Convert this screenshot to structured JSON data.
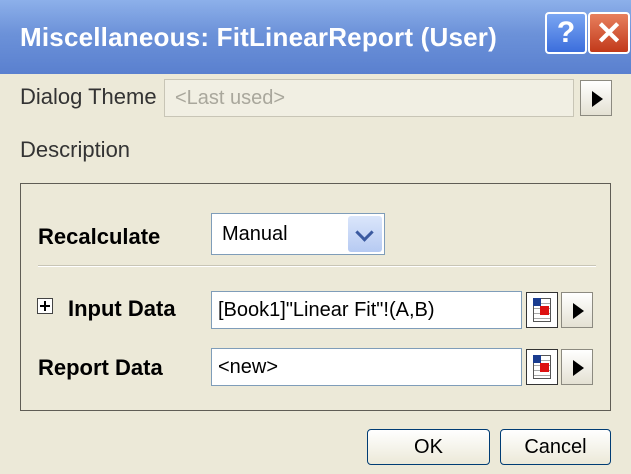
{
  "window": {
    "title": "Miscellaneous: FitLinearReport (User)",
    "help_label": "?",
    "close_label": "✕"
  },
  "dialog_theme": {
    "label": "Dialog Theme",
    "value": "<Last used>"
  },
  "description": {
    "label": "Description"
  },
  "recalculate": {
    "label": "Recalculate",
    "value": "Manual"
  },
  "input_data": {
    "label": "Input Data",
    "value": "[Book1]\"Linear Fit\"!(A,B)"
  },
  "report_data": {
    "label": "Report Data",
    "value": "<new>"
  },
  "buttons": {
    "ok": "OK",
    "cancel": "Cancel"
  }
}
